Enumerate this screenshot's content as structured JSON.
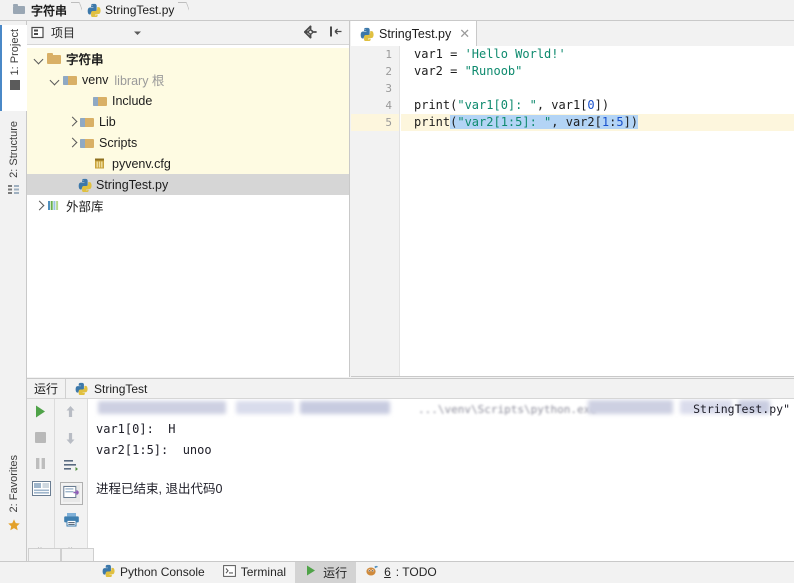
{
  "breadcrumb": {
    "items": [
      {
        "label": "字符串",
        "icon": "project-folder-icon"
      },
      {
        "label": "StringTest.py",
        "icon": "python-file-icon"
      }
    ]
  },
  "left_strip": {
    "tabs": [
      {
        "label": "1: Project",
        "name": "sidebar-tab-project",
        "active": true
      },
      {
        "label": "2: Structure",
        "name": "sidebar-tab-structure",
        "active": false
      },
      {
        "label": "2: Favorites",
        "name": "sidebar-tab-favorites",
        "active": false
      }
    ]
  },
  "project_panel": {
    "title": "项目",
    "dropdown_icon": "chevron-down-icon",
    "settings_icon": "gear-icon",
    "hide_icon": "hide-panel-icon",
    "tree": [
      {
        "label": "字符串",
        "sublabel": "",
        "depth": 0,
        "twisty": "down",
        "icon": "folder-icon",
        "state": "modified",
        "bold": true
      },
      {
        "label": "venv",
        "sublabel": "library 根",
        "depth": 1,
        "twisty": "down",
        "icon": "library-folder-icon",
        "state": "modified",
        "bold": false
      },
      {
        "label": "Include",
        "sublabel": "",
        "depth": 2,
        "twisty": "none",
        "icon": "library-folder-icon",
        "state": "modified",
        "bold": false
      },
      {
        "label": "Lib",
        "sublabel": "",
        "depth": 2,
        "twisty": "right",
        "icon": "library-folder-icon",
        "state": "modified",
        "bold": false
      },
      {
        "label": "Scripts",
        "sublabel": "",
        "depth": 2,
        "twisty": "right",
        "icon": "library-folder-icon",
        "state": "modified",
        "bold": false
      },
      {
        "label": "pyvenv.cfg",
        "sublabel": "",
        "depth": 2,
        "twisty": "none",
        "icon": "config-file-icon",
        "state": "modified",
        "bold": false
      },
      {
        "label": "StringTest.py",
        "sublabel": "",
        "depth": 1,
        "twisty": "none",
        "icon": "python-file-icon",
        "state": "selected",
        "bold": false
      },
      {
        "label": "外部库",
        "sublabel": "",
        "depth": 0,
        "twisty": "right",
        "icon": "external-libraries-icon",
        "state": "normal",
        "bold": false
      }
    ]
  },
  "editor": {
    "tab": {
      "label": "StringTest.py",
      "icon": "python-file-icon",
      "close_icon": "close-icon"
    },
    "line_numbers": [
      "1",
      "2",
      "3",
      "4",
      "5"
    ],
    "current_line": 5,
    "code": [
      "var1 = 'Hello World!'",
      "var2 = \"Runoob\"",
      "",
      "print(\"var1[0]: \", var1[0])",
      "print(\"var2[1:5]: \", var2[1:5])"
    ]
  },
  "run_panel": {
    "tab_label": "运行",
    "config_name": "StringTest",
    "config_icon": "python-file-icon",
    "toolbar_left": [
      {
        "name": "rerun-button",
        "icon": "play-icon"
      },
      {
        "name": "stop-button",
        "icon": "stop-icon"
      },
      {
        "name": "pause-button",
        "icon": "pause-icon"
      },
      {
        "name": "layout-button",
        "icon": "layout-icon"
      }
    ],
    "toolbar_right": [
      {
        "name": "up-button",
        "icon": "arrow-up-icon"
      },
      {
        "name": "down-button",
        "icon": "arrow-down-icon"
      },
      {
        "name": "soft-wrap-button",
        "icon": "soft-wrap-icon"
      },
      {
        "name": "scroll-end-button",
        "icon": "scroll-to-end-icon"
      },
      {
        "name": "print-button",
        "icon": "print-icon"
      }
    ],
    "expand_icon": "chevron-double-right-icon",
    "console": {
      "command_line_tail": "StringTest.py\"",
      "command_line_ghost": "...\\venv\\Scripts\\python.exe",
      "output": [
        "var1[0]:  H",
        "var2[1:5]:  unoo"
      ],
      "exit_message": "进程已结束, 退出代码0"
    }
  },
  "status_bar": {
    "items": [
      {
        "label": "Python Console",
        "icon": "python-console-icon",
        "active": false,
        "name": "status-tab-python-console"
      },
      {
        "label": "Terminal",
        "icon": "terminal-icon",
        "active": false,
        "name": "status-tab-terminal"
      },
      {
        "label": "运行",
        "icon": "play-icon",
        "active": true,
        "name": "status-tab-run"
      },
      {
        "label": "6: TODO",
        "icon": "todo-icon",
        "active": false,
        "name": "status-tab-todo"
      }
    ]
  },
  "colors": {
    "string_literal": "#0e8a6e",
    "number_literal": "#1750cd",
    "selection": "#b3d4f5",
    "current_line": "#fdf6dd",
    "modified_row": "#fefbe2",
    "selected_row": "#d6d6d6"
  }
}
